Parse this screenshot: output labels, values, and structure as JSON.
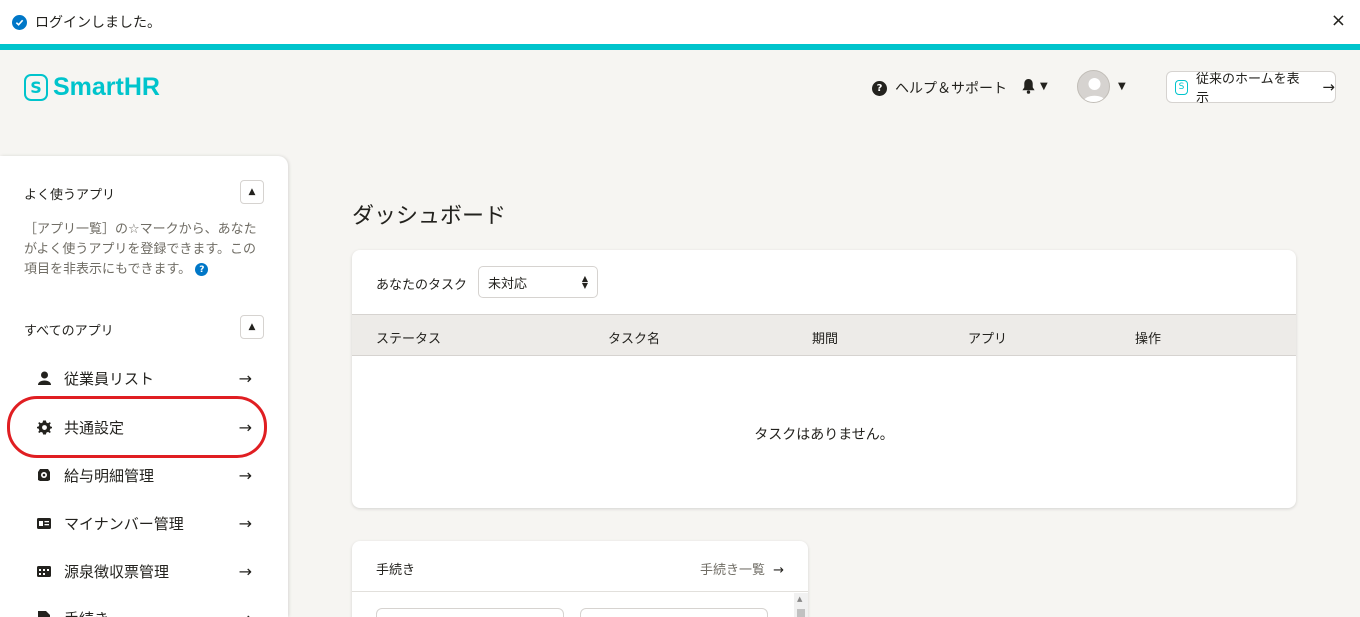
{
  "toast": {
    "message": "ログインしました。",
    "close": "×"
  },
  "header": {
    "logo_text": "SmartHR",
    "logo_mark": "S",
    "help_label": "ヘルプ＆サポート",
    "home_button_label": "従来のホームを表示"
  },
  "sidebar": {
    "favorites": {
      "title": "よく使うアプリ",
      "description": "［アプリ一覧］の☆マークから、あなたがよく使うアプリを登録できます。この項目を非表示にもできます。"
    },
    "all_apps": {
      "title": "すべてのアプリ",
      "items": [
        {
          "label": "従業員リスト",
          "icon": "person-icon"
        },
        {
          "label": "共通設定",
          "icon": "gear-icon"
        },
        {
          "label": "給与明細管理",
          "icon": "payslip-icon"
        },
        {
          "label": "マイナンバー管理",
          "icon": "id-card-icon"
        },
        {
          "label": "源泉徴収票管理",
          "icon": "document-icon"
        },
        {
          "label": "手続き",
          "icon": "file-icon"
        }
      ]
    },
    "highlight_color": "#e01e22"
  },
  "main": {
    "title": "ダッシュボード",
    "tasks": {
      "label": "あなたのタスク",
      "filter_value": "未対応",
      "columns": [
        "ステータス",
        "タスク名",
        "期間",
        "アプリ",
        "操作"
      ],
      "empty_message": "タスクはありません。"
    },
    "procedures": {
      "title": "手続き",
      "link_label": "手続き一覧"
    }
  },
  "colors": {
    "brand": "#00c4cc",
    "accent": "#0077c7",
    "background": "#f6f5f2"
  }
}
